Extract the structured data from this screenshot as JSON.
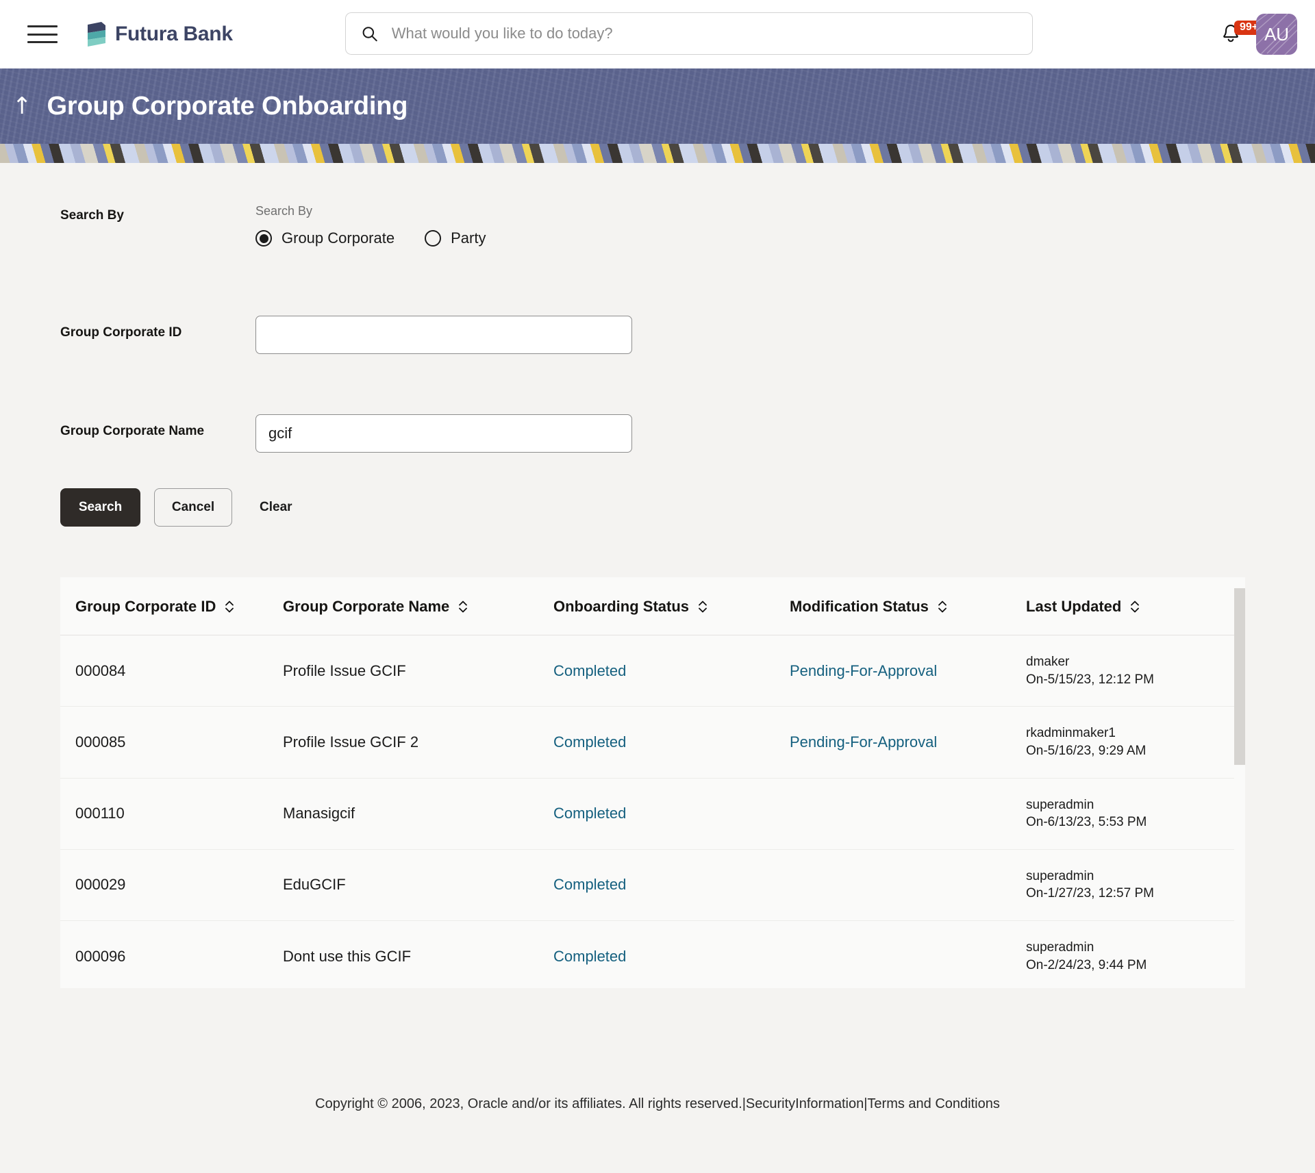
{
  "topnav": {
    "menu_icon": "hamburger-menu-icon",
    "logo_icon": "futura-bank-logo-icon",
    "brand_name": "Futura Bank",
    "search": {
      "icon": "search-icon",
      "placeholder": "What would you like to do today?",
      "value": ""
    },
    "notification": {
      "icon": "bell-icon",
      "badge": "99+",
      "badge_color": "#d93513"
    },
    "avatar": {
      "initials": "AU",
      "color": "#8d71a8"
    }
  },
  "banner": {
    "back_icon": "back-arrow-icon",
    "title": "Group Corporate Onboarding",
    "background_color": "#5d6590"
  },
  "search_form": {
    "search_by_label": "Search By",
    "radio_group_label": "Search By",
    "options": [
      {
        "label": "Group Corporate",
        "selected": true
      },
      {
        "label": "Party",
        "selected": false
      }
    ],
    "fields": [
      {
        "label": "Group Corporate ID",
        "value": "",
        "placeholder": ""
      },
      {
        "label": "Group Corporate Name",
        "value": "gcif",
        "placeholder": ""
      }
    ],
    "buttons": {
      "search": "Search",
      "cancel": "Cancel",
      "clear": "Clear"
    }
  },
  "results_table": {
    "columns": [
      {
        "label": "Group Corporate ID",
        "sortable": true
      },
      {
        "label": "Group Corporate Name",
        "sortable": true
      },
      {
        "label": "Onboarding Status",
        "sortable": true
      },
      {
        "label": "Modification Status",
        "sortable": true
      },
      {
        "label": "Last Updated",
        "sortable": true
      }
    ],
    "link_color": "#15607f",
    "rows": [
      {
        "id": "000084",
        "name": "Profile Issue GCIF",
        "onboarding_status": "Completed",
        "modification_status": "Pending-For-Approval",
        "updated_by": "dmaker",
        "updated_on": "On-5/15/23, 12:12 PM"
      },
      {
        "id": "000085",
        "name": "Profile Issue GCIF 2",
        "onboarding_status": "Completed",
        "modification_status": "Pending-For-Approval",
        "updated_by": "rkadminmaker1",
        "updated_on": "On-5/16/23, 9:29 AM"
      },
      {
        "id": "000110",
        "name": "Manasigcif",
        "onboarding_status": "Completed",
        "modification_status": "",
        "updated_by": "superadmin",
        "updated_on": "On-6/13/23, 5:53 PM"
      },
      {
        "id": "000029",
        "name": "EduGCIF",
        "onboarding_status": "Completed",
        "modification_status": "",
        "updated_by": "superadmin",
        "updated_on": "On-1/27/23, 12:57 PM"
      },
      {
        "id": "000096",
        "name": "Dont use this GCIF",
        "onboarding_status": "Completed",
        "modification_status": "",
        "updated_by": "superadmin",
        "updated_on": "On-2/24/23, 9:44 PM"
      }
    ]
  },
  "footer": {
    "copyright": "Copyright © 2006, 2023, Oracle and/or its affiliates. All rights reserved.",
    "sep1": "|",
    "security_link": "SecurityInformation",
    "sep2": "|",
    "terms_link": "Terms and Conditions"
  }
}
